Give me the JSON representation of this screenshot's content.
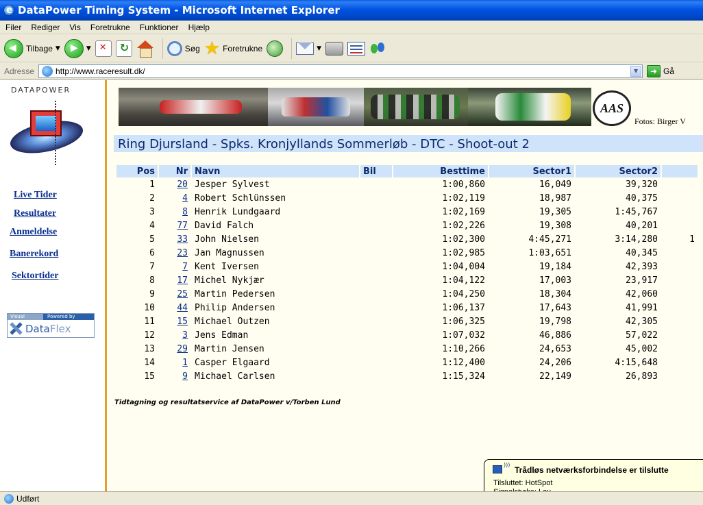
{
  "window": {
    "title": "DataPower Timing System - Microsoft Internet Explorer"
  },
  "menu": [
    "Filer",
    "Rediger",
    "Vis",
    "Foretrukne",
    "Funktioner",
    "Hjælp"
  ],
  "toolbar": {
    "back_label": "Tilbage",
    "search_label": "Søg",
    "favorites_label": "Foretrukne"
  },
  "address": {
    "label": "Adresse",
    "url": "http://www.raceresult.dk/",
    "go_label": "Gå"
  },
  "sidebar": {
    "logo_text": "DATAPOWER",
    "links": [
      "Live Tider",
      "Resultater",
      "Anmeldelse",
      "Banerekord",
      "Sektortider"
    ],
    "dataflex": {
      "visual": "Visual",
      "powered_by": "Powered by",
      "name_a": "Data",
      "name_b": "Flex"
    }
  },
  "banner": {
    "logo_text": "AAS",
    "credit": "Fotos: Birger V"
  },
  "event_title": "Ring Djursland - Spks. Kronjyllands Sommerløb - DTC - Shoot-out 2",
  "table": {
    "headers": {
      "pos": "Pos",
      "nr": "Nr",
      "name": "Navn",
      "bil": "Bil",
      "best": "Besttime",
      "s1": "Sector1",
      "s2": "Sector2"
    },
    "rows": [
      {
        "pos": "1",
        "nr": "20",
        "name": "Jesper Sylvest",
        "best": "1:00,860",
        "s1": "16,049",
        "s2": "39,320",
        "s3": ""
      },
      {
        "pos": "2",
        "nr": "4",
        "name": "Robert Schlünssen",
        "best": "1:02,119",
        "s1": "18,987",
        "s2": "40,375",
        "s3": ""
      },
      {
        "pos": "3",
        "nr": "8",
        "name": "Henrik Lundgaard",
        "best": "1:02,169",
        "s1": "19,305",
        "s2": "1:45,767",
        "s3": ""
      },
      {
        "pos": "4",
        "nr": "77",
        "name": "David Falch",
        "best": "1:02,226",
        "s1": "19,308",
        "s2": "40,201",
        "s3": ""
      },
      {
        "pos": "5",
        "nr": "33",
        "name": "John Nielsen",
        "best": "1:02,300",
        "s1": "4:45,271",
        "s2": "3:14,280",
        "s3": "1"
      },
      {
        "pos": "6",
        "nr": "23",
        "name": "Jan Magnussen",
        "best": "1:02,985",
        "s1": "1:03,651",
        "s2": "40,345",
        "s3": ""
      },
      {
        "pos": "7",
        "nr": "7",
        "name": "Kent Iversen",
        "best": "1:04,004",
        "s1": "19,184",
        "s2": "42,393",
        "s3": ""
      },
      {
        "pos": "8",
        "nr": "17",
        "name": "Michel Nykjær",
        "best": "1:04,122",
        "s1": "17,003",
        "s2": "23,917",
        "s3": ""
      },
      {
        "pos": "9",
        "nr": "25",
        "name": "Martin Pedersen",
        "best": "1:04,250",
        "s1": "18,304",
        "s2": "42,060",
        "s3": ""
      },
      {
        "pos": "10",
        "nr": "44",
        "name": "Philip Andersen",
        "best": "1:06,137",
        "s1": "17,643",
        "s2": "41,991",
        "s3": ""
      },
      {
        "pos": "11",
        "nr": "15",
        "name": "Michael Outzen",
        "best": "1:06,325",
        "s1": "19,798",
        "s2": "42,305",
        "s3": ""
      },
      {
        "pos": "12",
        "nr": "3",
        "name": "Jens Edman",
        "best": "1:07,032",
        "s1": "46,886",
        "s2": "57,022",
        "s3": ""
      },
      {
        "pos": "13",
        "nr": "29",
        "name": "Martin Jensen",
        "best": "1:10,266",
        "s1": "24,653",
        "s2": "45,002",
        "s3": ""
      },
      {
        "pos": "14",
        "nr": "1",
        "name": "Casper Elgaard",
        "best": "1:12,400",
        "s1": "24,206",
        "s2": "4:15,648",
        "s3": ""
      },
      {
        "pos": "15",
        "nr": "9",
        "name": "Michael Carlsen",
        "best": "1:15,324",
        "s1": "22,149",
        "s2": "26,893",
        "s3": ""
      }
    ]
  },
  "footer_note": "Tidtagning og resultatservice af DataPower v/Torben Lund",
  "balloon": {
    "title": "Trådløs netværksforbindelse er tilslutte",
    "connected": "Tilsluttet: HotSpot",
    "signal": "Signalstyrke: Lav"
  },
  "status": {
    "text": "Udført"
  }
}
